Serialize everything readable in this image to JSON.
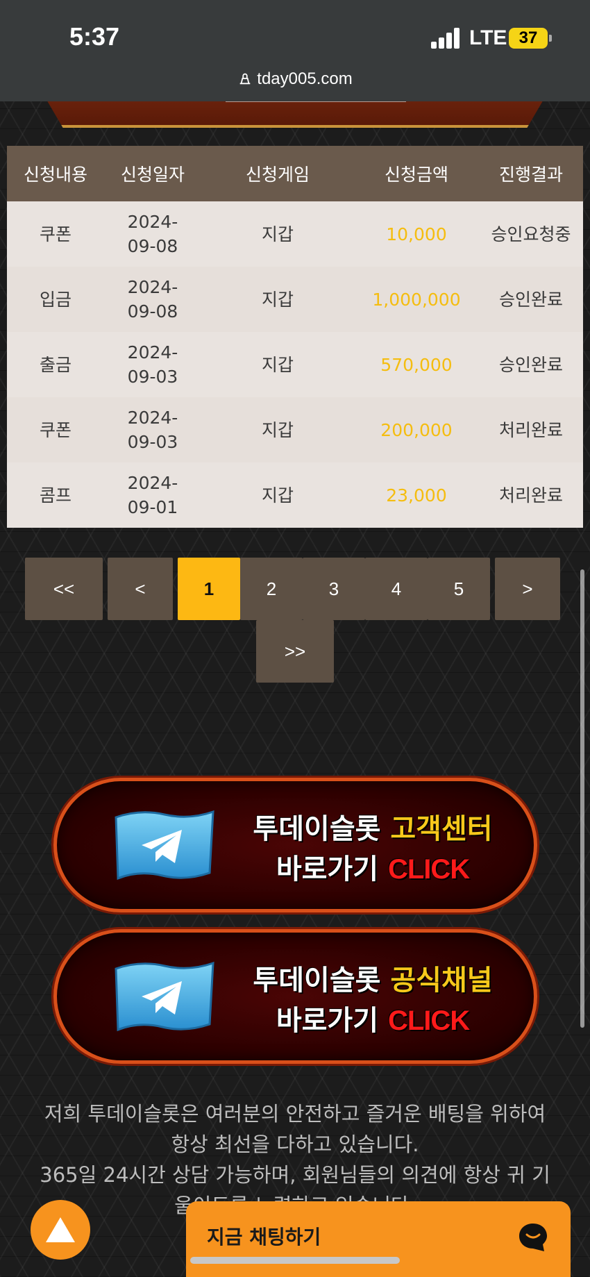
{
  "status": {
    "time": "5:37",
    "network": "LTE",
    "battery": "37"
  },
  "browser": {
    "url": "tday005.com"
  },
  "table": {
    "headers": [
      "신청내용",
      "신청일자",
      "신청게임",
      "신청금액",
      "진행결과"
    ],
    "rows": [
      {
        "type": "쿠폰",
        "date": "2024-09-08",
        "game": "지갑",
        "amount": "10,000",
        "result": "승인요청중"
      },
      {
        "type": "입금",
        "date": "2024-09-08",
        "game": "지갑",
        "amount": "1,000,000",
        "result": "승인완료"
      },
      {
        "type": "출금",
        "date": "2024-09-03",
        "game": "지갑",
        "amount": "570,000",
        "result": "승인완료"
      },
      {
        "type": "쿠폰",
        "date": "2024-09-03",
        "game": "지갑",
        "amount": "200,000",
        "result": "처리완료"
      },
      {
        "type": "콤프",
        "date": "2024-09-01",
        "game": "지갑",
        "amount": "23,000",
        "result": "처리완료"
      }
    ]
  },
  "pagination": {
    "first": "<<",
    "prev": "<",
    "pages": [
      "1",
      "2",
      "3",
      "4",
      "5"
    ],
    "current": "1",
    "next": ">",
    "last": ">>"
  },
  "cta": [
    {
      "line1_white": "투데이슬롯 ",
      "line1_yellow": "고객센터",
      "line2_white": "바로가기 ",
      "line2_red": "CLICK",
      "icon": "telegram-icon"
    },
    {
      "line1_white": "투데이슬롯 ",
      "line1_yellow": "공식채널",
      "line2_white": "바로가기 ",
      "line2_red": "CLICK",
      "icon": "telegram-icon"
    }
  ],
  "footer": {
    "line1": "저희 투데이슬롯은 여러분의 안전하고 즐거운 배팅을 위하여 항상 최선을 다하고 있습니다.",
    "line2": "365일 24시간 상담 가능하며, 회원님들의 의견에 항상 귀 기울이도록 노력하고 있습니다."
  },
  "chat": {
    "label": "지금 채팅하기"
  },
  "colors": {
    "accent": "#f7931e",
    "active_page": "#fdb813",
    "amount": "#f5bd0f",
    "header": "#6a5a4c"
  }
}
